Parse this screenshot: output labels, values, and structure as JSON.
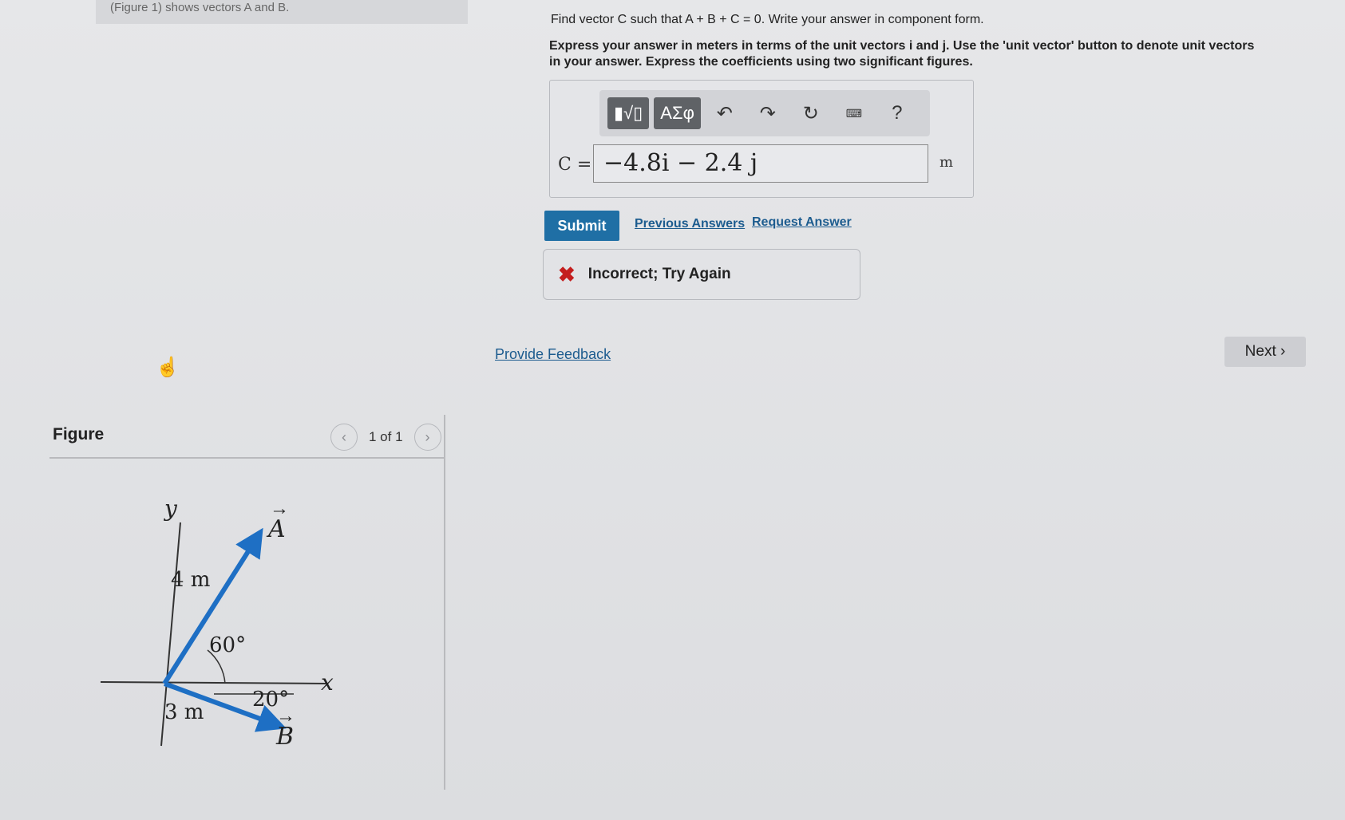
{
  "caption": "(Figure 1) shows vectors A and B.",
  "figure_panel": {
    "title": "Figure",
    "pager": "1 of 1",
    "prev_icon": "chevron-left-icon",
    "next_icon": "chevron-right-icon",
    "diagram": {
      "axis_y": "y",
      "axis_x": "x",
      "vector_a_label": "A",
      "vector_a_magnitude": "4 m",
      "vector_a_angle": "60°",
      "vector_b_label": "B",
      "vector_b_magnitude": "3 m",
      "vector_b_angle": "20°",
      "vector_color": "#1e6fc4"
    }
  },
  "question": {
    "line1": "Find vector C such that A + B + C = 0. Write your answer in component form.",
    "line2": "Express your answer in meters in terms of the unit vectors i and j. Use the 'unit vector' button to denote unit vectors in your answer. Express the coefficients using two significant figures."
  },
  "answer": {
    "toolbar": {
      "templates_icon": "templates-icon",
      "greek_label": "ΑΣφ",
      "undo_icon": "undo-icon",
      "redo_icon": "redo-icon",
      "reset_icon": "reset-icon",
      "keyboard_icon": "keyboard-icon",
      "help_label": "?"
    },
    "variable_label": "C =",
    "value": "−4.8i − 2.4 j",
    "unit": "m"
  },
  "actions": {
    "submit": "Submit",
    "previous_answers": "Previous Answers",
    "request_answer": "Request Answer"
  },
  "feedback": {
    "status_icon": "x-icon",
    "status_color": "#c41e1e",
    "message": "Incorrect; Try Again"
  },
  "footer": {
    "provide_feedback": "Provide Feedback",
    "next": "Next"
  }
}
